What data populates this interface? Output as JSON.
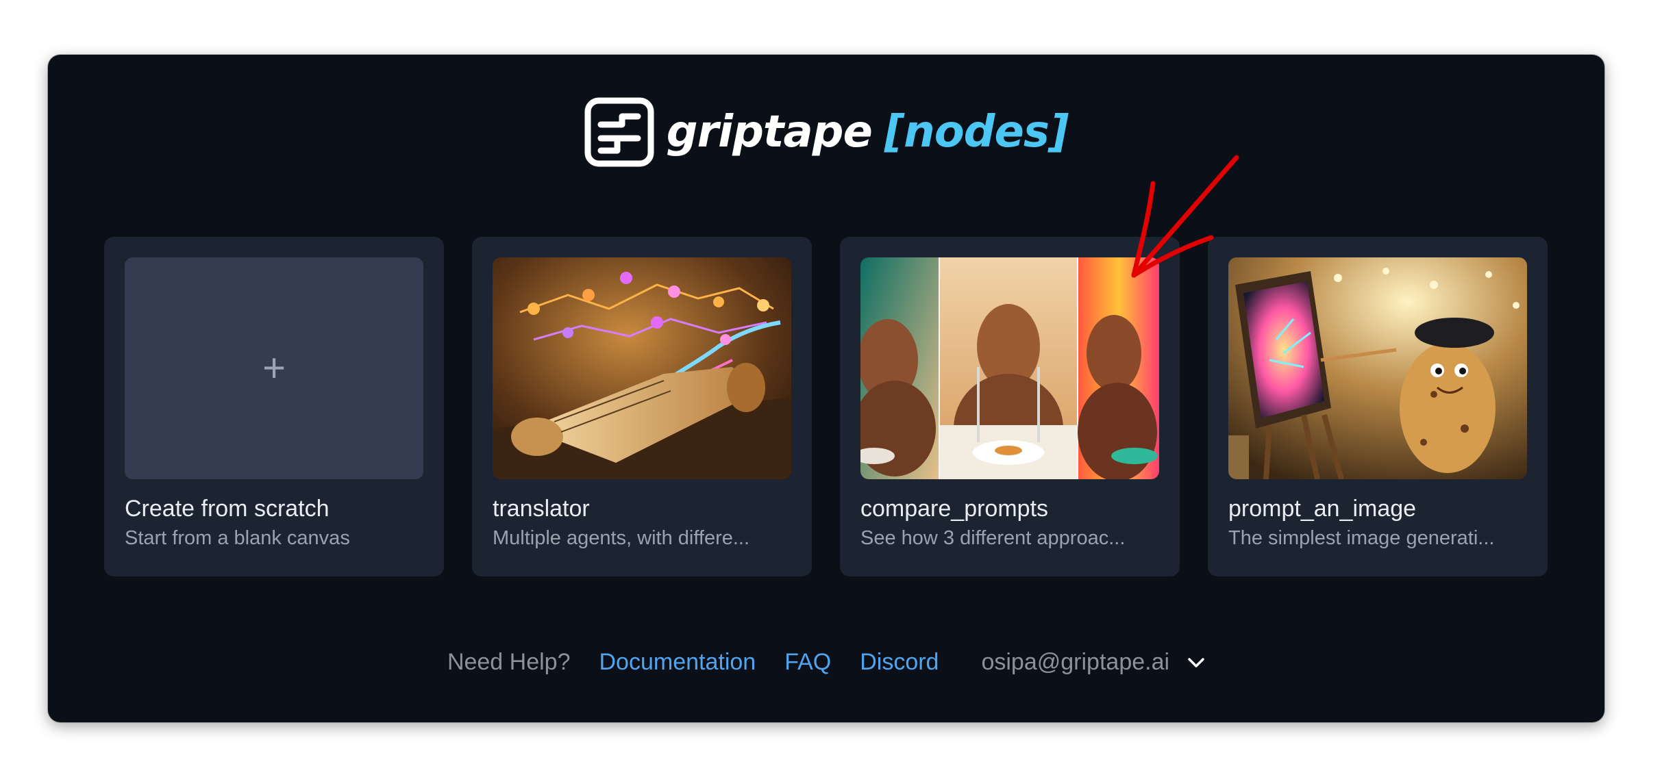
{
  "brand": {
    "name": "griptape",
    "product": "[nodes]"
  },
  "cards": [
    {
      "title": "Create from scratch",
      "description": "Start from a blank canvas",
      "thumb_icon": "plus-icon"
    },
    {
      "title": "translator",
      "description": "Multiple agents, with differe..."
    },
    {
      "title": "compare_prompts",
      "description": "See how 3 different approac..."
    },
    {
      "title": "prompt_an_image",
      "description": "The simplest image generati..."
    }
  ],
  "footer": {
    "help_label": "Need Help?",
    "links": [
      "Documentation",
      "FAQ",
      "Discord"
    ],
    "account": "osipa@griptape.ai"
  },
  "colors": {
    "background": "#0a0f18",
    "card": "#1c2432",
    "accent": "#4cc6f2",
    "link": "#4fa5f0",
    "annotation_arrow": "#e30000"
  }
}
